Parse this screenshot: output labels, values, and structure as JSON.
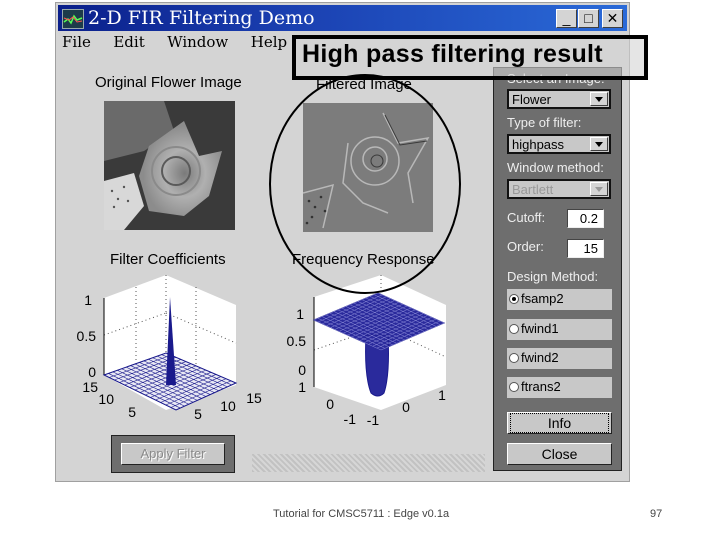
{
  "window": {
    "title": "2-D FIR Filtering Demo",
    "controls": {
      "minimize": "_",
      "maximize": "□",
      "close": "✕"
    }
  },
  "menu": [
    "File",
    "Edit",
    "Window",
    "Help"
  ],
  "annotation": {
    "banner": "High pass filtering result"
  },
  "axes": {
    "original_title": "Original Flower Image",
    "filtered_title": "Filtered Image",
    "coeff_title": "Filter Coefficients",
    "freq_title": "Frequency Response"
  },
  "coeff_plot": {
    "z_ticks": [
      "1",
      "0.5",
      "0"
    ],
    "y_ticks": [
      "15",
      "10",
      "5"
    ],
    "x_ticks": [
      "5",
      "10",
      "15"
    ]
  },
  "freq_plot": {
    "z_ticks": [
      "1",
      "0.5",
      "0"
    ],
    "y_ticks": [
      "1",
      "0",
      "-1"
    ],
    "x_ticks": [
      "-1",
      "0",
      "1"
    ]
  },
  "controls": {
    "select_image_label": "Select an Image:",
    "image_value": "Flower",
    "filter_type_label": "Type of filter:",
    "filter_type_value": "highpass",
    "window_method_label": "Window method:",
    "window_method_value": "Bartlett",
    "cutoff_label": "Cutoff:",
    "cutoff_value": "0.2",
    "order_label": "Order:",
    "order_value": "15",
    "design_method_label": "Design Method:",
    "design_methods": [
      {
        "label": "fsamp2",
        "selected": true
      },
      {
        "label": "fwind1",
        "selected": false
      },
      {
        "label": "fwind2",
        "selected": false
      },
      {
        "label": "ftrans2",
        "selected": false
      }
    ],
    "info_button": "Info",
    "close_button": "Close",
    "apply_button": "Apply Filter"
  },
  "footer": {
    "caption": "Tutorial for CMSC5711 : Edge v0.1a",
    "page_number": "97"
  },
  "colors": {
    "titlebar": "#0a1f8a",
    "surface_mesh": "#1a1a8c",
    "panel": "#6e6e6e",
    "window_bg": "#d4d4d4"
  }
}
